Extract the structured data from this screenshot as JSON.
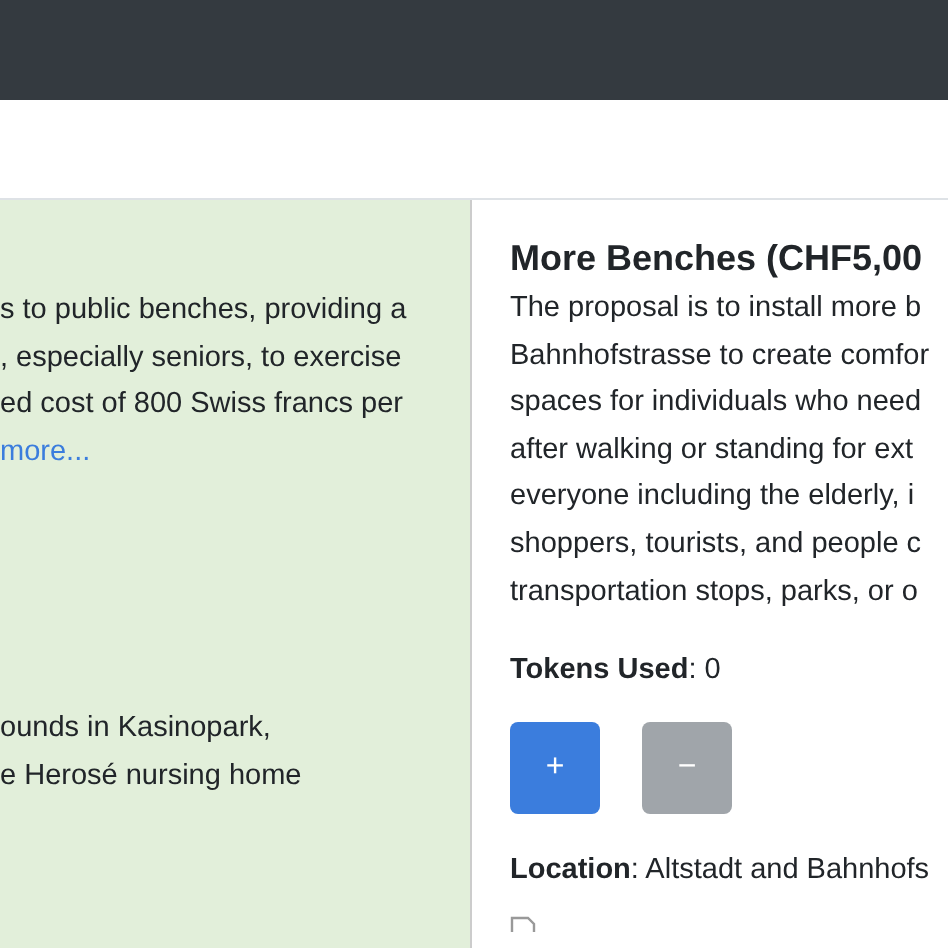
{
  "left_card": {
    "description_lines": [
      "s to public benches, providing a",
      ", especially seniors, to exercise",
      "ed cost of 800 Swiss francs per"
    ],
    "read_more": "more...",
    "location_lines": [
      "ounds in Kasinopark,",
      "e Herosé nursing home"
    ]
  },
  "right_card": {
    "title": "More Benches (CHF5,00",
    "description_lines": [
      "The proposal is to install more b",
      "Bahnhofstrasse to create comfor",
      "spaces for individuals who need",
      "after walking or standing for ext",
      "everyone including the elderly, i",
      "shoppers, tourists, and people c",
      "transportation stops, parks, or o"
    ],
    "tokens": "**Tokens Used**: 0",
    "buttons": [
      {
        "label": "+",
        "disabled": false
      },
      {
        "label": "−",
        "disabled": true
      }
    ],
    "location": "**Location**: Altstadt and Bahnhofs"
  }
}
